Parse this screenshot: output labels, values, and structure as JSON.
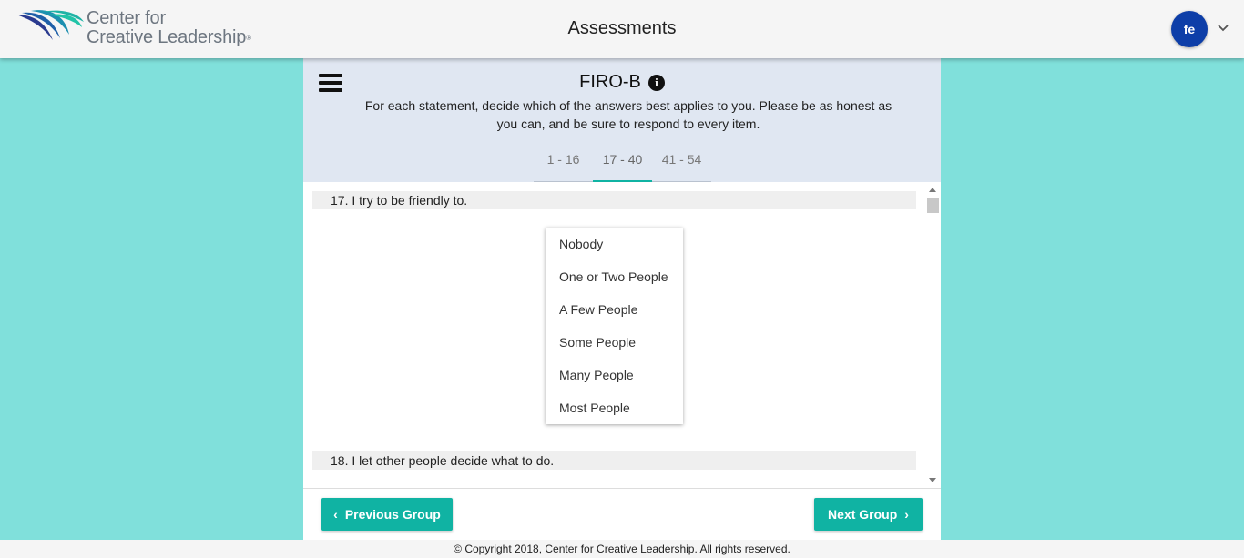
{
  "header": {
    "logo_line1": "Center for",
    "logo_line2": "Creative Leadership",
    "logo_tm": "®",
    "title": "Assessments",
    "avatar_initials": "fe"
  },
  "assessment": {
    "title": "FIRO-B",
    "instructions": "For each statement, decide which of the answers best applies to you. Please be as honest as you can, and be sure to respond to every item.",
    "tabs": [
      {
        "label": "1 - 16",
        "active": false
      },
      {
        "label": "17 - 40",
        "active": true
      },
      {
        "label": "41 - 54",
        "active": false
      }
    ]
  },
  "questions": [
    {
      "text": "17.  I try to be friendly to."
    },
    {
      "text": "18.  I let other people decide what to do."
    }
  ],
  "options": [
    "Nobody",
    "One or Two People",
    "A Few People",
    "Some People",
    "Many People",
    "Most People"
  ],
  "buttons": {
    "previous": "Previous Group",
    "next": "Next Group"
  },
  "footer": "© Copyright 2018, Center for Creative Leadership. All rights reserved.",
  "colors": {
    "accent": "#10b3a3",
    "page_background": "#80e0db",
    "header_panel": "#e0e7f2",
    "avatar": "#0d3ea8"
  }
}
